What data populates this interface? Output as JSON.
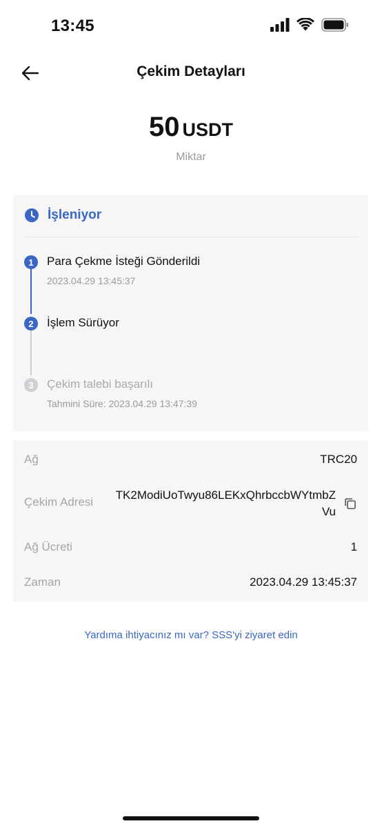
{
  "status_bar": {
    "time": "13:45"
  },
  "header": {
    "title": "Çekim Detayları"
  },
  "amount": {
    "value": "50",
    "unit": "USDT",
    "label": "Miktar"
  },
  "status": {
    "label": "İşleniyor",
    "steps": [
      {
        "number": "1",
        "title": "Para Çekme İsteği Gönderildi",
        "time": "2023.04.29 13:45:37"
      },
      {
        "number": "2",
        "title": "İşlem Sürüyor",
        "time": ""
      },
      {
        "number": "3",
        "title": "Çekim talebi başarılı",
        "time": "Tahmini Süre: 2023.04.29 13:47:39"
      }
    ]
  },
  "details": {
    "network_label": "Ağ",
    "network_value": "TRC20",
    "address_label": "Çekim Adresi",
    "address_value": "TK2ModiUoTwyu86LEKxQhrbccbWYtmbZVu",
    "fee_label": "Ağ Ücreti",
    "fee_value": "1",
    "time_label": "Zaman",
    "time_value": "2023.04.29 13:45:37"
  },
  "help": {
    "text": "Yardıma ihtiyacınız mı var? SSS'yi ziyaret edin"
  },
  "colors": {
    "accent": "#3a66c6",
    "card": "#f6f6f7",
    "muted": "#a6a6aa"
  }
}
